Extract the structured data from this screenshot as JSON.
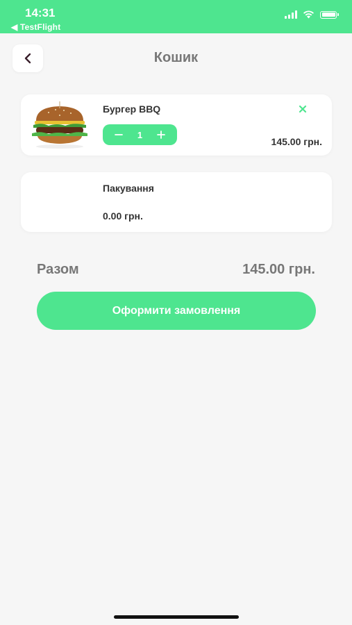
{
  "status_bar": {
    "time": "14:31",
    "back_app": "◀ TestFlight",
    "icons": [
      "signal-icon",
      "wifi-icon",
      "battery-icon"
    ]
  },
  "header": {
    "back_icon": "chevron-left-icon",
    "title": "Кошик"
  },
  "cart": {
    "items": [
      {
        "name": "Бургер BBQ",
        "quantity": "1",
        "price": "145.00 грн.",
        "image": "burger-image",
        "remove_icon": "close-icon"
      }
    ],
    "packaging": {
      "name": "Пакування",
      "price": "0.00 грн."
    }
  },
  "summary": {
    "total_label": "Разом",
    "total_value": "145.00 грн."
  },
  "checkout": {
    "label": "Оформити замовлення"
  },
  "colors": {
    "accent": "#4ee58f",
    "background": "#f6f6f6",
    "muted_text": "#777777"
  }
}
